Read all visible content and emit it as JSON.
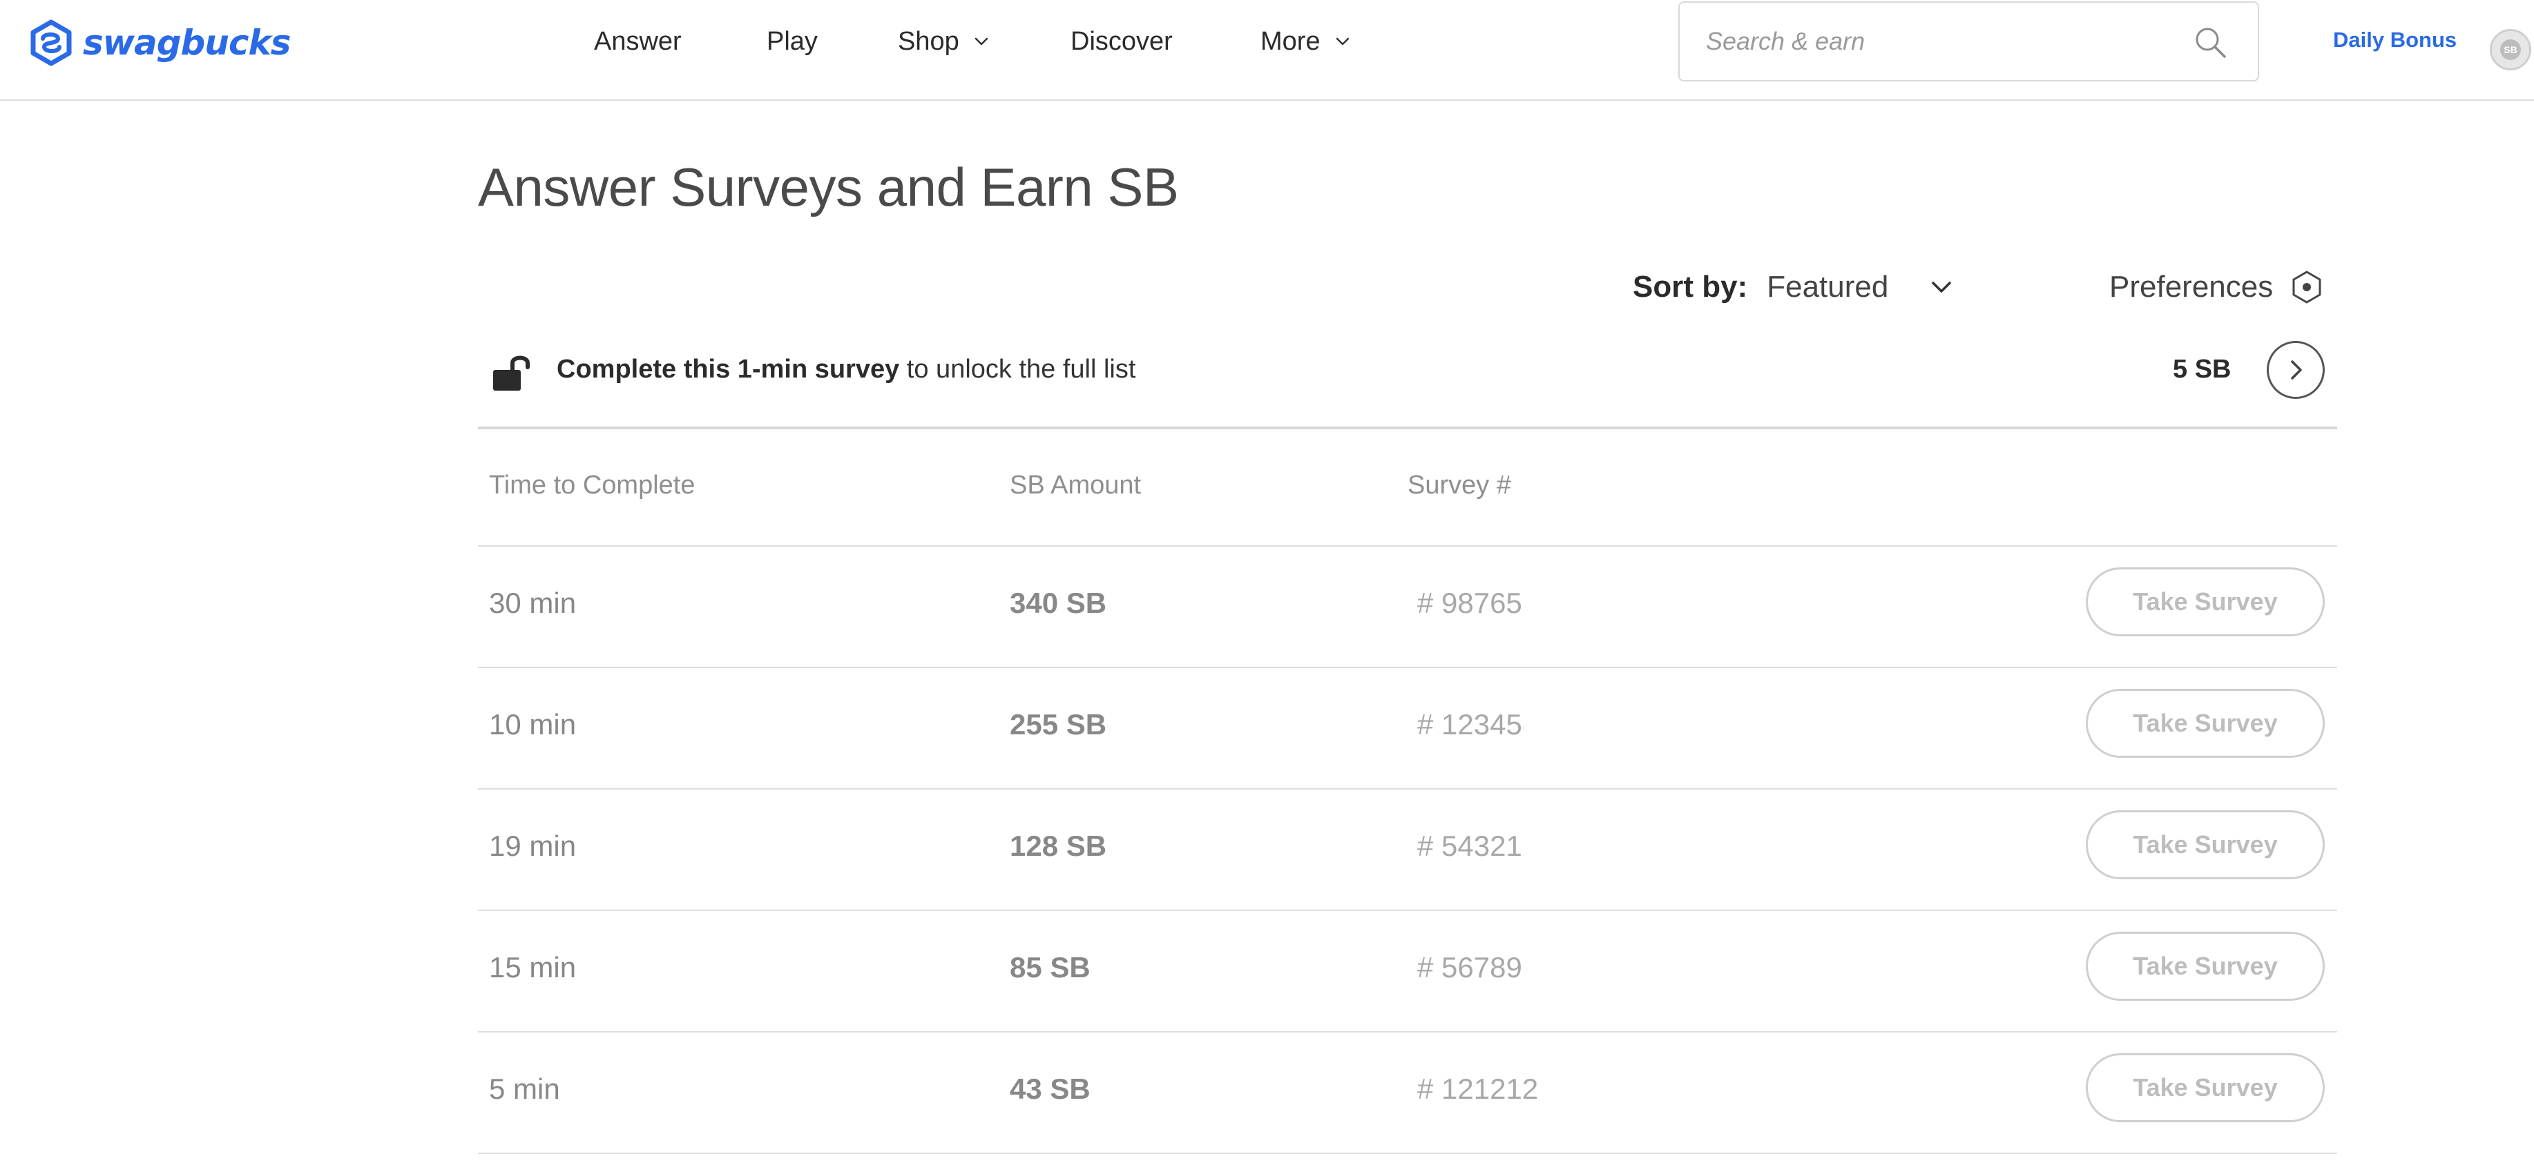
{
  "brand": {
    "name": "swagbucks",
    "color": "#2a6ae6"
  },
  "nav": {
    "items": [
      {
        "label": "Answer",
        "has_dropdown": false
      },
      {
        "label": "Play",
        "has_dropdown": false
      },
      {
        "label": "Shop",
        "has_dropdown": true
      },
      {
        "label": "Discover",
        "has_dropdown": false
      },
      {
        "label": "More",
        "has_dropdown": true
      }
    ]
  },
  "search": {
    "placeholder": "Search & earn",
    "value": "",
    "icon": "search-icon"
  },
  "header": {
    "daily_bonus": "Daily Bonus",
    "avatar_icon": "sb-coin-icon",
    "avatar_text": "SB"
  },
  "main": {
    "title": "Answer Surveys and Earn SB",
    "sort": {
      "label": "Sort by:",
      "value": "Featured"
    },
    "preferences_label": "Preferences",
    "unlock": {
      "bold_text": "Complete this 1-min survey",
      "text": " to unlock the full list",
      "reward": "5 SB"
    },
    "columns": {
      "time": "Time to Complete",
      "sb": "SB Amount",
      "number": "Survey #"
    },
    "surveys": [
      {
        "time": "30 min",
        "sb": "340 SB",
        "number": "# 98765",
        "action": "Take Survey"
      },
      {
        "time": "10 min",
        "sb": "255 SB",
        "number": "# 12345",
        "action": "Take Survey"
      },
      {
        "time": "19 min",
        "sb": "128 SB",
        "number": "# 54321",
        "action": "Take Survey"
      },
      {
        "time": "15 min",
        "sb": "85 SB",
        "number": "# 56789",
        "action": "Take Survey"
      },
      {
        "time": "5 min",
        "sb": "43 SB",
        "number": "# 121212",
        "action": "Take Survey"
      }
    ]
  }
}
